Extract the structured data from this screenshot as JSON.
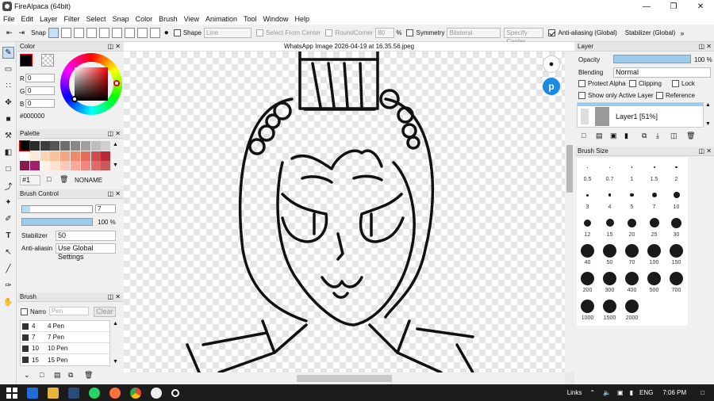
{
  "window": {
    "title": "FireAlpaca (64bit)"
  },
  "menu": [
    "File",
    "Edit",
    "Layer",
    "Filter",
    "Select",
    "Snap",
    "Color",
    "Brush",
    "View",
    "Animation",
    "Tool",
    "Window",
    "Help"
  ],
  "toolbar": {
    "snap_label": "Snap",
    "shape_label": "Shape",
    "shape_value": "Line",
    "select_from_center": "Select From Center",
    "round_corner": "RoundCorner",
    "round_corner_value": "80",
    "percent": "%",
    "symmetry_label": "Symmetry",
    "symmetry_value": "Bilateral",
    "specify_center": "Specify Center",
    "antialias_label": "Anti-aliasing (Global)",
    "stabilizer_label": "Stabilizer (Global)"
  },
  "color_panel": {
    "title": "Color",
    "r_label": "R",
    "r_value": "0",
    "g_label": "G",
    "g_value": "0",
    "b_label": "B",
    "b_value": "0",
    "hex": "#000000"
  },
  "palette_panel": {
    "title": "Palette",
    "colors": [
      "#000000",
      "#2b2b2b",
      "#3d3d3d",
      "#555555",
      "#6e6e6e",
      "#888888",
      "#a0a0a0",
      "#bdbdbd",
      "#cfcfcf",
      "#ffffff",
      "#fde9d9",
      "#fad4b5",
      "#f8c29a",
      "#f4a582",
      "#f28a6a",
      "#e66b59",
      "#d04a4a",
      "#b82a3a",
      "#8a1a4a",
      "#a0206a",
      "#fff2e6",
      "#fde0d0",
      "#fbc9b8",
      "#f7a99a",
      "#f08880",
      "#e06a6a",
      "#c85a5a"
    ],
    "slot": "#1",
    "name": "NONAME"
  },
  "brush_control": {
    "title": "Brush Control",
    "size_value": "7",
    "opacity_value": "100 %",
    "opacity": 1.0,
    "stabilizer_label": "Stabilizer",
    "stabilizer_value": "50",
    "antialias_label": "Anti-aliasin",
    "antialias_value": "Use Global Settings"
  },
  "brush_panel": {
    "title": "Brush",
    "narrow_label": "Narro",
    "search_placeholder": "Pen",
    "clear_label": "Clear",
    "items": [
      {
        "size": "4",
        "name": "4 Pen"
      },
      {
        "size": "7",
        "name": "7 Pen"
      },
      {
        "size": "10",
        "name": "10 Pen"
      },
      {
        "size": "15",
        "name": "15 Pen"
      }
    ]
  },
  "canvas": {
    "tab_title": "WhatsApp Image 2026-04-19 at 16.35.56.jpeg"
  },
  "layer_panel": {
    "title": "Layer",
    "opacity_label": "Opacity",
    "opacity_value": "100 %",
    "opacity": 1.0,
    "blending_label": "Blending",
    "blending_value": "Normal",
    "protect_alpha": "Protect Alpha",
    "clipping": "Clipping",
    "lock": "Lock",
    "show_only_active": "Show only Active Layer",
    "reference": "Reference",
    "layer_name": "Layer1 [51%]"
  },
  "brush_size_panel": {
    "title": "Brush Size",
    "sizes": [
      "0.5",
      "0.7",
      "1",
      "1.5",
      "2",
      "3",
      "4",
      "5",
      "7",
      "10",
      "12",
      "15",
      "20",
      "25",
      "30",
      "40",
      "50",
      "70",
      "100",
      "150",
      "200",
      "300",
      "400",
      "500",
      "700",
      "1000",
      "1500",
      "2000"
    ]
  },
  "taskbar": {
    "links": "Links",
    "lang": "ENG",
    "time": "7:06 PM"
  }
}
